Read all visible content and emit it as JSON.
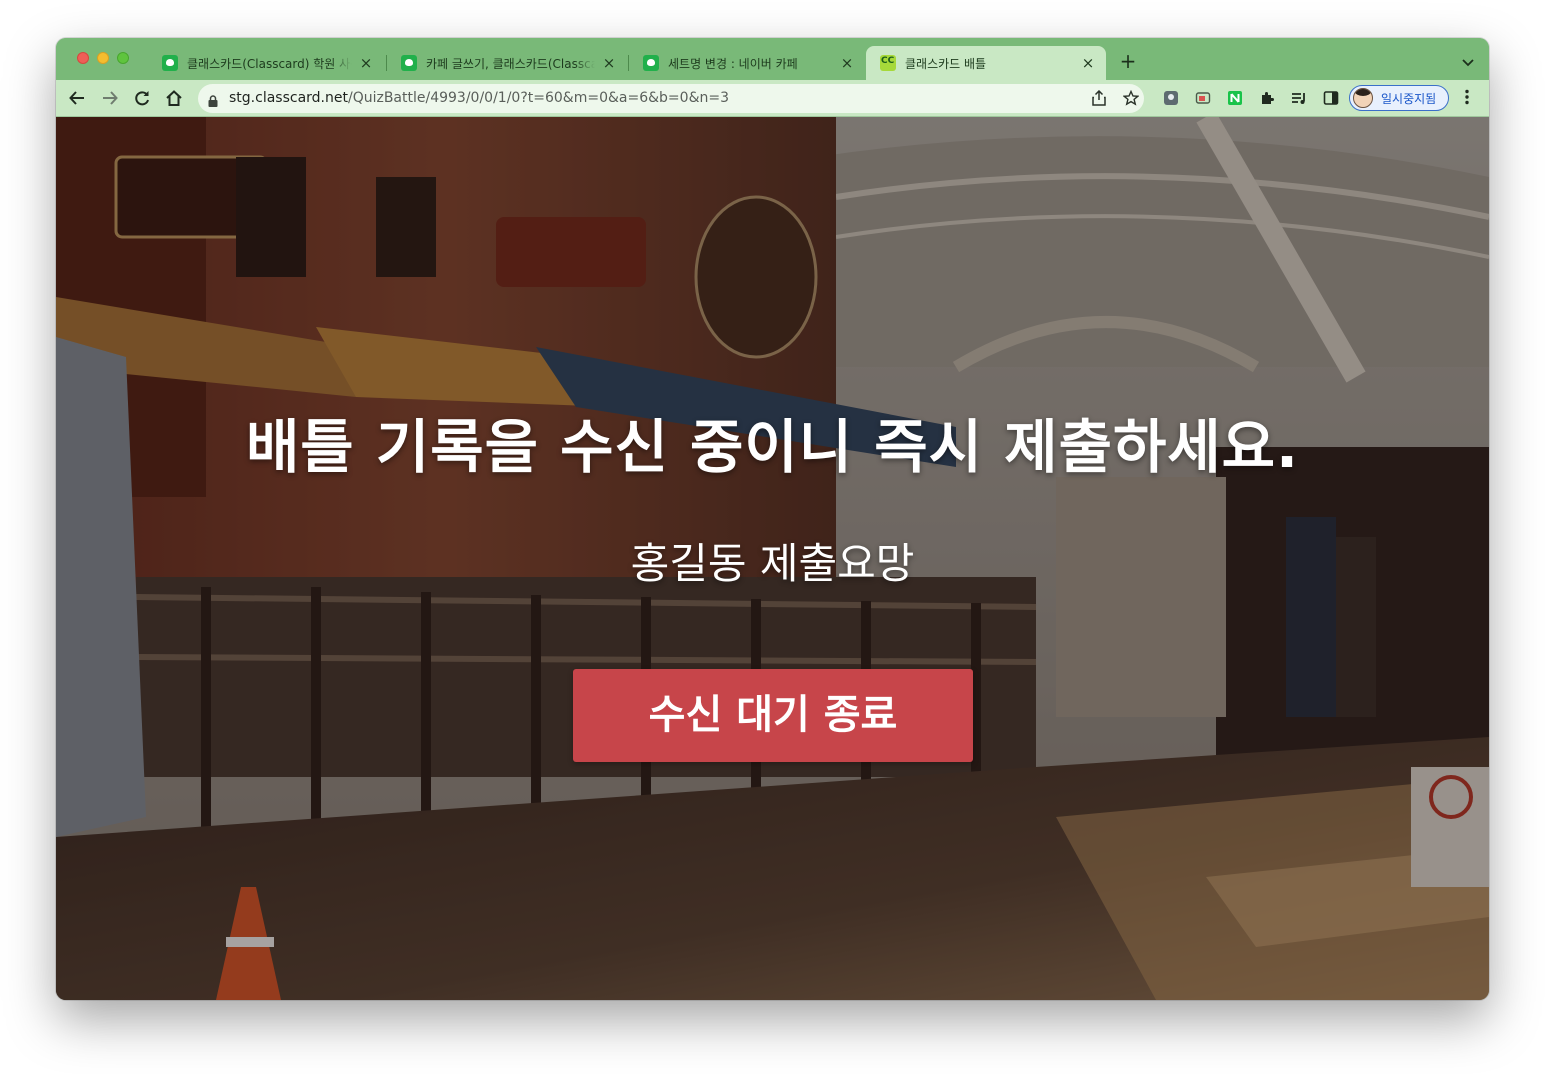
{
  "browser": {
    "tabs": [
      {
        "title": "클래스카드(Classcard) 학원 사용자",
        "favicon": "classcard-green-icon",
        "active": false
      },
      {
        "title": "카페 글쓰기, 클래스카드(Classcard)",
        "favicon": "classcard-green-icon",
        "active": false
      },
      {
        "title": "세트명 변경 : 네이버 카페",
        "favicon": "classcard-green-icon",
        "active": false
      },
      {
        "title": "클래스카드 배틀",
        "favicon": "cc-logo-icon",
        "active": true
      }
    ],
    "close_glyph": "×",
    "new_tab_glyph": "+",
    "url_host": "stg.classcard.net",
    "url_path": "/QuizBattle/4993/0/0/1/0?t=60&m=0&a=6&b=0&n=3",
    "profile_label": "일시중지됨",
    "cc_favicon_text": "CC"
  },
  "page": {
    "headline": "배틀 기록을 수신 중이니 즉시 제출하세요.",
    "subline": "홍길동 제출요망",
    "stop_button_label": "수신 대기 종료",
    "button_color": "#c7454a"
  }
}
